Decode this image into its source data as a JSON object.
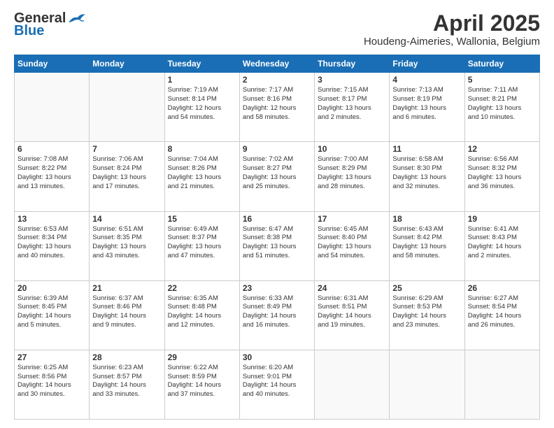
{
  "header": {
    "logo_line1": "General",
    "logo_line2": "Blue",
    "title": "April 2025",
    "subtitle": "Houdeng-Aimeries, Wallonia, Belgium"
  },
  "weekdays": [
    "Sunday",
    "Monday",
    "Tuesday",
    "Wednesday",
    "Thursday",
    "Friday",
    "Saturday"
  ],
  "weeks": [
    [
      {
        "day": "",
        "info": ""
      },
      {
        "day": "",
        "info": ""
      },
      {
        "day": "1",
        "info": "Sunrise: 7:19 AM\nSunset: 8:14 PM\nDaylight: 12 hours\nand 54 minutes."
      },
      {
        "day": "2",
        "info": "Sunrise: 7:17 AM\nSunset: 8:16 PM\nDaylight: 12 hours\nand 58 minutes."
      },
      {
        "day": "3",
        "info": "Sunrise: 7:15 AM\nSunset: 8:17 PM\nDaylight: 13 hours\nand 2 minutes."
      },
      {
        "day": "4",
        "info": "Sunrise: 7:13 AM\nSunset: 8:19 PM\nDaylight: 13 hours\nand 6 minutes."
      },
      {
        "day": "5",
        "info": "Sunrise: 7:11 AM\nSunset: 8:21 PM\nDaylight: 13 hours\nand 10 minutes."
      }
    ],
    [
      {
        "day": "6",
        "info": "Sunrise: 7:08 AM\nSunset: 8:22 PM\nDaylight: 13 hours\nand 13 minutes."
      },
      {
        "day": "7",
        "info": "Sunrise: 7:06 AM\nSunset: 8:24 PM\nDaylight: 13 hours\nand 17 minutes."
      },
      {
        "day": "8",
        "info": "Sunrise: 7:04 AM\nSunset: 8:26 PM\nDaylight: 13 hours\nand 21 minutes."
      },
      {
        "day": "9",
        "info": "Sunrise: 7:02 AM\nSunset: 8:27 PM\nDaylight: 13 hours\nand 25 minutes."
      },
      {
        "day": "10",
        "info": "Sunrise: 7:00 AM\nSunset: 8:29 PM\nDaylight: 13 hours\nand 28 minutes."
      },
      {
        "day": "11",
        "info": "Sunrise: 6:58 AM\nSunset: 8:30 PM\nDaylight: 13 hours\nand 32 minutes."
      },
      {
        "day": "12",
        "info": "Sunrise: 6:56 AM\nSunset: 8:32 PM\nDaylight: 13 hours\nand 36 minutes."
      }
    ],
    [
      {
        "day": "13",
        "info": "Sunrise: 6:53 AM\nSunset: 8:34 PM\nDaylight: 13 hours\nand 40 minutes."
      },
      {
        "day": "14",
        "info": "Sunrise: 6:51 AM\nSunset: 8:35 PM\nDaylight: 13 hours\nand 43 minutes."
      },
      {
        "day": "15",
        "info": "Sunrise: 6:49 AM\nSunset: 8:37 PM\nDaylight: 13 hours\nand 47 minutes."
      },
      {
        "day": "16",
        "info": "Sunrise: 6:47 AM\nSunset: 8:38 PM\nDaylight: 13 hours\nand 51 minutes."
      },
      {
        "day": "17",
        "info": "Sunrise: 6:45 AM\nSunset: 8:40 PM\nDaylight: 13 hours\nand 54 minutes."
      },
      {
        "day": "18",
        "info": "Sunrise: 6:43 AM\nSunset: 8:42 PM\nDaylight: 13 hours\nand 58 minutes."
      },
      {
        "day": "19",
        "info": "Sunrise: 6:41 AM\nSunset: 8:43 PM\nDaylight: 14 hours\nand 2 minutes."
      }
    ],
    [
      {
        "day": "20",
        "info": "Sunrise: 6:39 AM\nSunset: 8:45 PM\nDaylight: 14 hours\nand 5 minutes."
      },
      {
        "day": "21",
        "info": "Sunrise: 6:37 AM\nSunset: 8:46 PM\nDaylight: 14 hours\nand 9 minutes."
      },
      {
        "day": "22",
        "info": "Sunrise: 6:35 AM\nSunset: 8:48 PM\nDaylight: 14 hours\nand 12 minutes."
      },
      {
        "day": "23",
        "info": "Sunrise: 6:33 AM\nSunset: 8:49 PM\nDaylight: 14 hours\nand 16 minutes."
      },
      {
        "day": "24",
        "info": "Sunrise: 6:31 AM\nSunset: 8:51 PM\nDaylight: 14 hours\nand 19 minutes."
      },
      {
        "day": "25",
        "info": "Sunrise: 6:29 AM\nSunset: 8:53 PM\nDaylight: 14 hours\nand 23 minutes."
      },
      {
        "day": "26",
        "info": "Sunrise: 6:27 AM\nSunset: 8:54 PM\nDaylight: 14 hours\nand 26 minutes."
      }
    ],
    [
      {
        "day": "27",
        "info": "Sunrise: 6:25 AM\nSunset: 8:56 PM\nDaylight: 14 hours\nand 30 minutes."
      },
      {
        "day": "28",
        "info": "Sunrise: 6:23 AM\nSunset: 8:57 PM\nDaylight: 14 hours\nand 33 minutes."
      },
      {
        "day": "29",
        "info": "Sunrise: 6:22 AM\nSunset: 8:59 PM\nDaylight: 14 hours\nand 37 minutes."
      },
      {
        "day": "30",
        "info": "Sunrise: 6:20 AM\nSunset: 9:01 PM\nDaylight: 14 hours\nand 40 minutes."
      },
      {
        "day": "",
        "info": ""
      },
      {
        "day": "",
        "info": ""
      },
      {
        "day": "",
        "info": ""
      }
    ]
  ]
}
